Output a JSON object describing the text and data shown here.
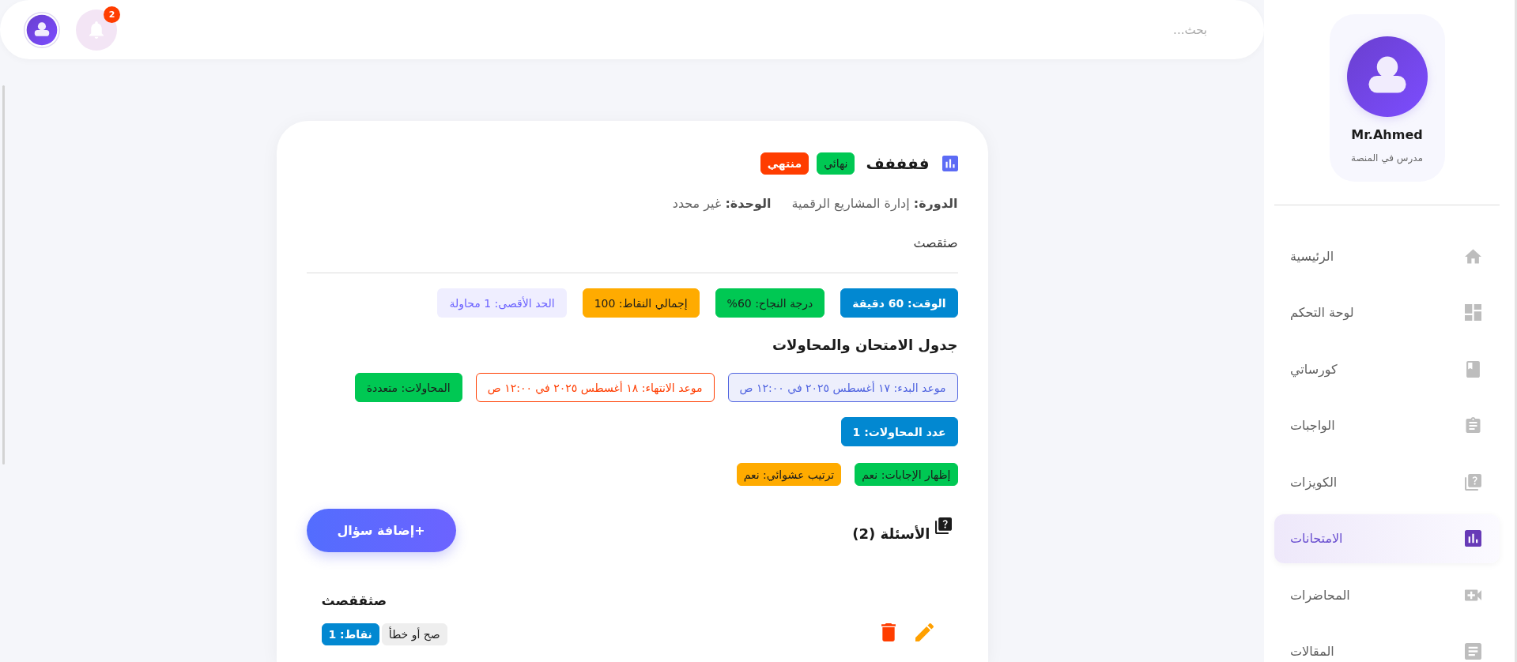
{
  "topbar": {
    "search": {
      "placeholder": "بحث..."
    },
    "notifications": {
      "count": "2"
    }
  },
  "sidebar": {
    "profile": {
      "name": "Mr.Ahmed",
      "role": "مدرس في المنصة"
    },
    "items": [
      {
        "label": "الرئيسية",
        "selected": false
      },
      {
        "label": "لوحة التحكم",
        "selected": false
      },
      {
        "label": "كورساتي",
        "selected": false
      },
      {
        "label": "الواجبات",
        "selected": false
      },
      {
        "label": "الكويزات",
        "selected": false
      },
      {
        "label": "الامتحانات",
        "selected": true
      },
      {
        "label": "المحاضرات",
        "selected": false
      },
      {
        "label": "المقالات",
        "selected": false
      }
    ]
  },
  "exam": {
    "title": "ففففف",
    "tags": [
      {
        "label": "نهائي",
        "kind": "filled",
        "color": "#00c853"
      },
      {
        "label": "منتهي",
        "kind": "filled",
        "color": "#ff3d00"
      }
    ],
    "meta": [
      "**الدورة:** إدارة المشاريع الرقمية",
      "**الوحدة:** غير محدد"
    ],
    "description": "صثقصث",
    "stats": [
      {
        "label": "الوقت: 60 دقيقة",
        "kind": "filled",
        "color": "#0288d1"
      },
      {
        "label": "درجة النجاح: 60%",
        "kind": "filled",
        "color": "#00c853"
      },
      {
        "label": "إجمالي النقاط: 100",
        "kind": "filled",
        "color": "#ffab00"
      },
      {
        "label": "الحد الأقصى: 1 محاولة",
        "kind": "soft",
        "color": "#6c63ff"
      }
    ],
    "schedule": {
      "title": "جدول الامتحان والمحاولات",
      "timing": [
        {
          "label": "موعد البدء: ١٧ أغسطس ٢٠٢٥ في ١٢:٠٠ ص",
          "kind": "soft-outline",
          "color": "#4f63e0"
        },
        {
          "label": "موعد الانتهاء: ١٨ أغسطس ٢٠٢٥ في ١٢:٠٠ ص",
          "kind": "outline",
          "color": "#ff3d00"
        },
        {
          "label": "المحاولات: متعددة",
          "kind": "filled",
          "color": "#00c853"
        }
      ],
      "attempts": [
        {
          "label": "عدد المحاولات: 1",
          "kind": "filled",
          "color": "#0288d1"
        }
      ],
      "options": [
        {
          "label": "إظهار الإجابات: نعم",
          "kind": "filled",
          "color": "#00c853"
        },
        {
          "label": "ترتيب عشوائي: نعم",
          "kind": "filled",
          "color": "#ffab00"
        }
      ]
    },
    "questions": {
      "title": "الأسئلة (2)",
      "add_button": "+إضافة سؤال",
      "items": [
        {
          "text": "صثققصث",
          "tags": [
            {
              "label": "صح أو خطأ",
              "kind": "filled",
              "color": "#eeeeee"
            },
            {
              "label": "نقاط: 1",
              "kind": "filled",
              "color": "#0288d1"
            }
          ]
        }
      ]
    }
  }
}
